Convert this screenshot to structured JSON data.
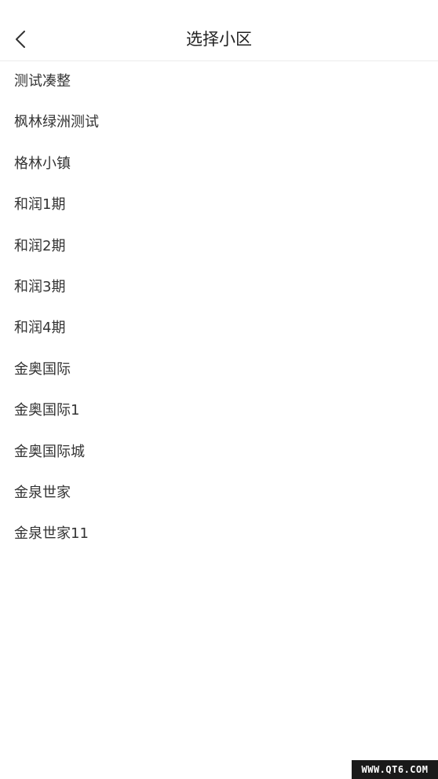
{
  "header": {
    "back_icon": "chevron-left-icon",
    "title": "选择小区"
  },
  "communities": [
    "测试凑整",
    "枫林绿洲测试",
    "格林小镇",
    "和润1期",
    "和润2期",
    "和润3期",
    "和润4期",
    "金奥国际",
    "金奥国际1",
    "金奥国际城",
    "金泉世家",
    "金泉世家11"
  ],
  "watermark": {
    "text": "WWW.QT6.COM"
  },
  "colors": {
    "background": "#ffffff",
    "text": "#333333",
    "title": "#222222",
    "divider": "#ececec"
  }
}
